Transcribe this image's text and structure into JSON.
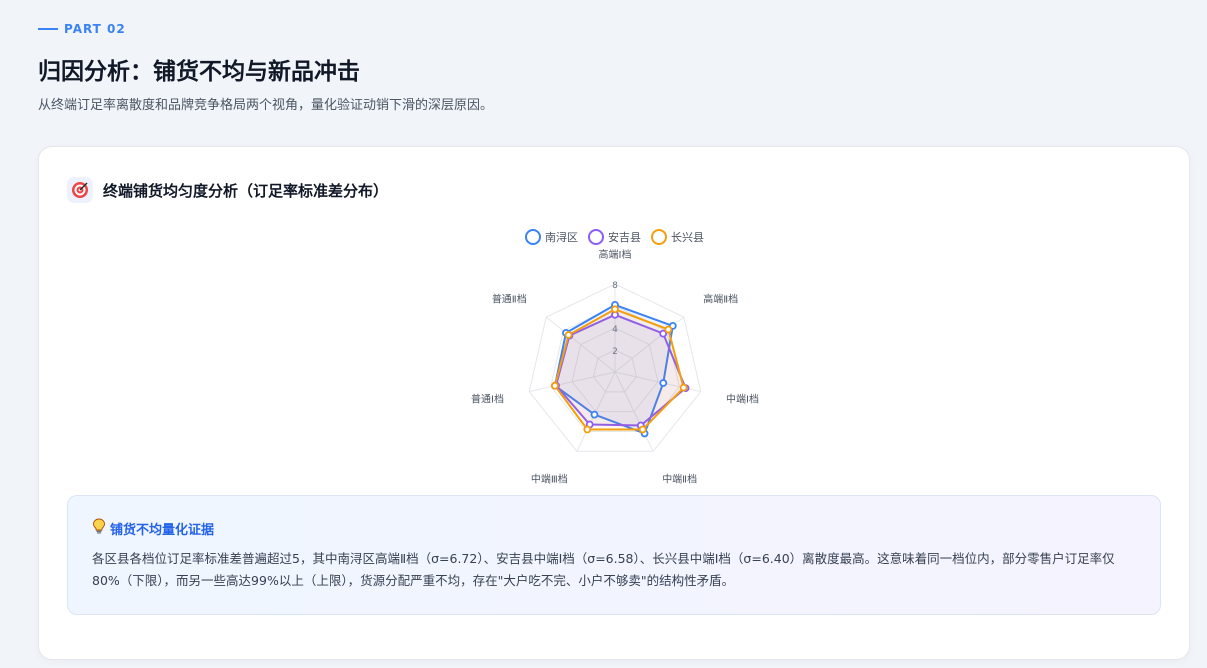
{
  "header": {
    "part_tag": "PART 02",
    "title": "归因分析：铺货不均与新品冲击",
    "subtitle": "从终端订足率离散度和品牌竞争格局两个视角，量化验证动销下滑的深层原因。"
  },
  "card": {
    "title": "终端铺货均匀度分析（订足率标准差分布）",
    "icon": "target-icon"
  },
  "chart_data": {
    "type": "radar",
    "categories": [
      "高端Ⅰ档",
      "高端Ⅱ档",
      "中端Ⅰ档",
      "中端Ⅱ档",
      "中端Ⅲ档",
      "普通Ⅰ档",
      "普通Ⅱ档"
    ],
    "rlim": [
      0,
      8
    ],
    "ticks": [
      2,
      4,
      6,
      8
    ],
    "tick_labels": [
      "2",
      "4",
      "8"
    ],
    "series": [
      {
        "name": "南浔区",
        "color": "#3b82f6",
        "values": [
          6.1,
          6.72,
          4.5,
          6.2,
          4.3,
          5.6,
          5.7
        ]
      },
      {
        "name": "安吉县",
        "color": "#8b5cf6",
        "values": [
          5.2,
          5.6,
          6.58,
          5.4,
          5.3,
          5.5,
          5.3
        ]
      },
      {
        "name": "长兴县",
        "color": "#f59e0b",
        "values": [
          5.7,
          6.2,
          6.4,
          5.8,
          5.8,
          5.6,
          5.4
        ]
      }
    ],
    "legend_position": "top",
    "grid": true
  },
  "insight": {
    "title": "铺货不均量化证据",
    "icon": "lightbulb-icon",
    "text": "各区县各档位订足率标准差普遍超过5，其中南浔区高端Ⅱ档（σ=6.72）、安吉县中端Ⅰ档（σ=6.58）、长兴县中端Ⅰ档（σ=6.40）离散度最高。这意味着同一档位内，部分零售户订足率仅80%（下限），而另一些高达99%以上（上限），货源分配严重不均，存在\"大户吃不完、小户不够卖\"的结构性矛盾。"
  }
}
